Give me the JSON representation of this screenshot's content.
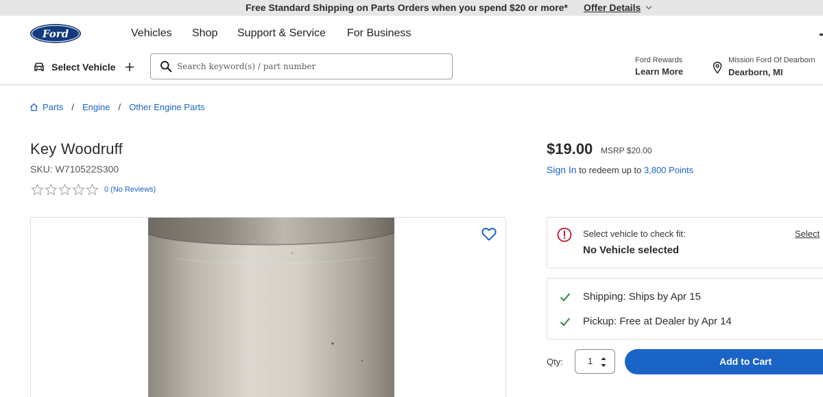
{
  "promo": {
    "message": "Free Standard Shipping on Parts Orders when you spend $20 or more*",
    "offer_details": "Offer Details"
  },
  "nav": {
    "logo_text": "Ford",
    "links": [
      "Vehicles",
      "Shop",
      "Support & Service",
      "For Business"
    ]
  },
  "subbar": {
    "select_vehicle": "Select Vehicle",
    "search_placeholder": "Search keyword(s) / part number",
    "rewards_label": "Ford Rewards",
    "rewards_link": "Learn More",
    "dealer_name": "Mission Ford Of Dearborn",
    "dealer_location": "Dearborn, MI"
  },
  "breadcrumb": [
    "Parts",
    "Engine",
    "Other Engine Parts"
  ],
  "product": {
    "title": "Key Woodruff",
    "sku": "SKU: W710522S300",
    "rating": 0,
    "reviews": "0 (No Reviews)",
    "price": "$19.00",
    "msrp": "MSRP $20.00",
    "sign_in": "Sign In",
    "redeem_text": " to redeem up to ",
    "points": "3,800 Points"
  },
  "fit": {
    "label": "Select vehicle to check fit:",
    "status": "No Vehicle selected",
    "select_link": "Select"
  },
  "availability": {
    "shipping": "Shipping: Ships by Apr 15",
    "pickup": "Pickup: Free at Dealer by Apr 14"
  },
  "cart": {
    "qty_label": "Qty:",
    "qty_value": "1",
    "add_to_cart": "Add to Cart"
  },
  "colors": {
    "brand_blue": "#1a64c8",
    "ford_logo": "#133a7c",
    "warning": "#c8102e",
    "check": "#2e8540"
  }
}
